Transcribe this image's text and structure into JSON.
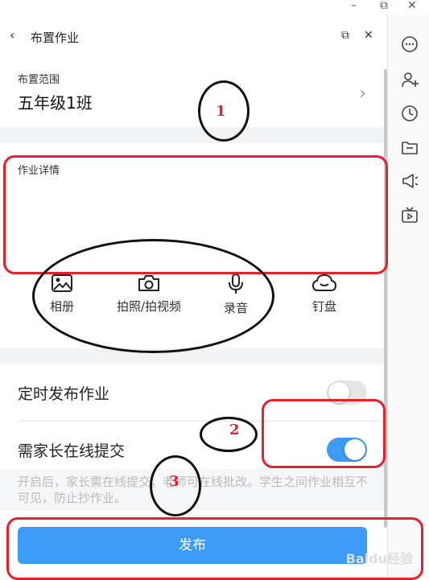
{
  "window": {
    "minimize_glyph": "–",
    "restore_glyph": "⧉",
    "close_glyph": "✕"
  },
  "header": {
    "back_glyph": "‹",
    "title": "布置作业",
    "popout_glyph": "⧉",
    "close_glyph": "✕"
  },
  "scope": {
    "label": "布置范围",
    "value": "五年级1班",
    "chevron_glyph": "›"
  },
  "detail": {
    "label": "作业详情",
    "placeholder": ""
  },
  "tools": [
    {
      "label": "相册",
      "icon": "image-icon"
    },
    {
      "label": "拍照/拍视频",
      "icon": "camera-icon"
    },
    {
      "label": "录音",
      "icon": "microphone-icon"
    },
    {
      "label": "钉盘",
      "icon": "cloud-drive-icon"
    }
  ],
  "settings": {
    "scheduled": {
      "label": "定时发布作业",
      "on": false
    },
    "parent_submit": {
      "label": "需家长在线提交",
      "on": true
    }
  },
  "note": "开启后，家长需在线提交，老师可在线批改。学生之间作业相互不可见，防止抄作业。",
  "publish_label": "发布",
  "annotations": {
    "n1": "1",
    "n2": "2",
    "n3": "3"
  },
  "watermark": "Baidu经验",
  "sidebar": [
    "chat-icon",
    "add-contact-icon",
    "history-icon",
    "folder-icon",
    "announcement-icon",
    "live-tv-icon"
  ],
  "colors": {
    "accent": "#3c9bf5",
    "annotation_red": "#e8202a",
    "toggle_off": "#e6e6e6"
  }
}
